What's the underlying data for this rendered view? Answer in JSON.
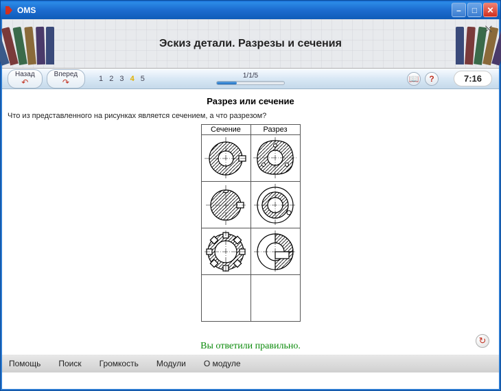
{
  "window": {
    "title": "OMS"
  },
  "header": {
    "title": "Эскиз детали. Разрезы и сечения"
  },
  "toolbar": {
    "back": "Назад",
    "forward": "Вперед",
    "steps": [
      "1",
      "2",
      "3",
      "4",
      "5"
    ],
    "current_step": 4,
    "progress_label": "1/1/5",
    "clock": "7:16"
  },
  "question": {
    "title": "Разрез или сечение",
    "text": "Что из представленного на рисунках является сечением, а что разрезом?",
    "col_a": "Сечение",
    "col_b": "Разрез"
  },
  "feedback": "Вы ответили правильно.",
  "menu": {
    "help": "Помощь",
    "search": "Поиск",
    "volume": "Громкость",
    "modules": "Модули",
    "about": "О модуле"
  }
}
